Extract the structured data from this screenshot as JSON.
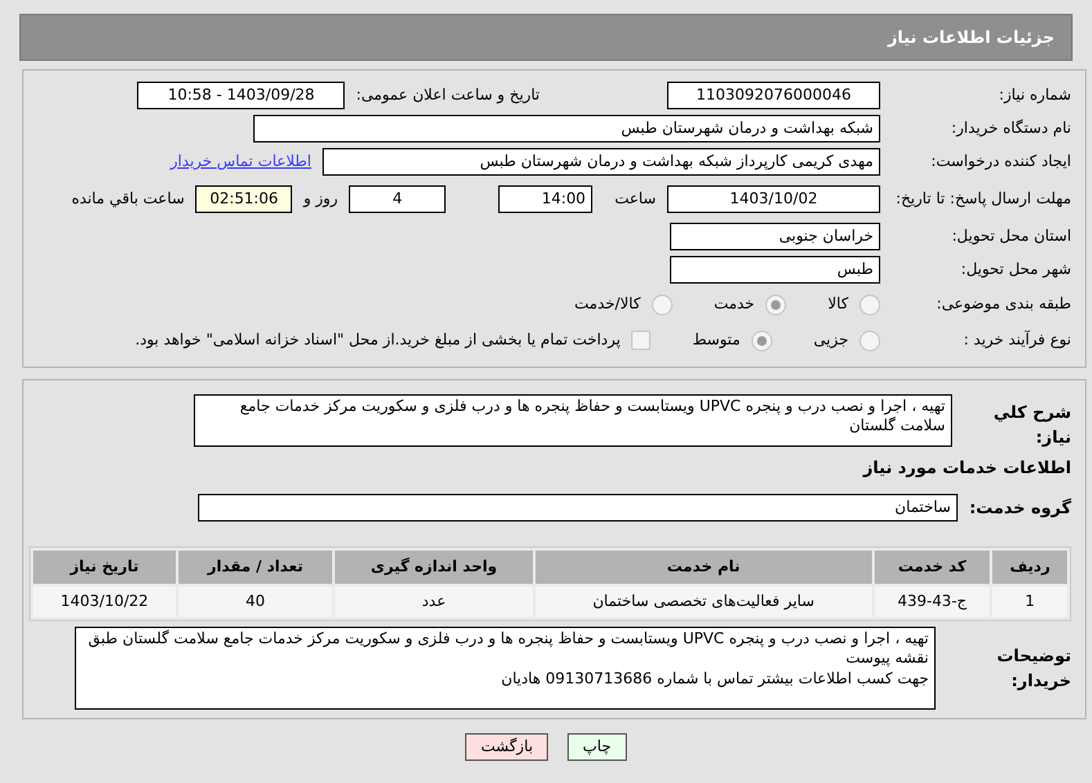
{
  "header": {
    "title": "جزئیات اطلاعات نیاز"
  },
  "need_number": {
    "label": "شماره نیاز:",
    "value": "1103092076000046"
  },
  "announce": {
    "label": "تاریخ و ساعت اعلان عمومی:",
    "value": "1403/09/28 - 10:58"
  },
  "buyer_org": {
    "label": "نام دستگاه خریدار:",
    "value": "شبکه بهداشت و درمان شهرستان طبس"
  },
  "requester": {
    "label": "ایجاد کننده درخواست:",
    "value": "مهدی کریمی کارپرداز شبکه بهداشت و درمان شهرستان طبس",
    "link": "اطلاعات تماس خریدار"
  },
  "deadline": {
    "label": "مهلت ارسال پاسخ: تا تاریخ:",
    "date": "1403/10/02",
    "time_label": "ساعت",
    "time": "14:00",
    "days": "4",
    "days_label": "روز و",
    "remaining": "02:51:06",
    "remaining_label": "ساعت باقي مانده"
  },
  "province": {
    "label": "استان محل تحویل:",
    "value": "خراسان جنوبی"
  },
  "city": {
    "label": "شهر محل تحویل:",
    "value": "طبس"
  },
  "category": {
    "label": "طبقه بندی موضوعی:",
    "options": [
      {
        "label": "کالا",
        "selected": false
      },
      {
        "label": "خدمت",
        "selected": true
      },
      {
        "label": "کالا/خدمت",
        "selected": false
      }
    ]
  },
  "process": {
    "label": "نوع فرآیند خرید :",
    "options": [
      {
        "label": "جزیی",
        "selected": false
      },
      {
        "label": "متوسط",
        "selected": true
      }
    ],
    "treasury": {
      "label": "پرداخت تمام یا بخشی از مبلغ خرید.از محل \"اسناد خزانه اسلامی\" خواهد بود.",
      "checked": false
    }
  },
  "description": {
    "label": "شرح کلي نیاز:",
    "value": "تهیه ، اجرا و نصب درب و پنجره UPVC ویستابست و حفاظ پنجره ها و درب فلزی و سکوریت مرکز خدمات جامع سلامت گلستان"
  },
  "services_heading": "اطلاعات خدمات مورد نیاز",
  "service_group": {
    "label": "گروه خدمت:",
    "value": "ساختمان"
  },
  "table": {
    "columns": [
      "ردیف",
      "کد خدمت",
      "نام خدمت",
      "واحد اندازه گیری",
      "تعداد / مقدار",
      "تاریخ نیاز"
    ],
    "rows": [
      [
        "1",
        "ج-43-439",
        "سایر فعالیت‌های تخصصی ساختمان",
        "عدد",
        "40",
        "1403/10/22"
      ]
    ]
  },
  "buyer_notes": {
    "label": "توضیحات خریدار:",
    "value": "تهیه ، اجرا و نصب درب و پنجره UPVC ویستابست و حفاظ پنجره ها و درب فلزی و سکوریت مرکز خدمات جامع سلامت گلستان طبق نقشه پیوست\nجهت کسب اطلاعات بیشتر تماس با شماره 09130713686 هادیان"
  },
  "buttons": [
    {
      "label": "چاپ",
      "kind": "print"
    },
    {
      "label": "بازگشت",
      "kind": "back"
    }
  ]
}
